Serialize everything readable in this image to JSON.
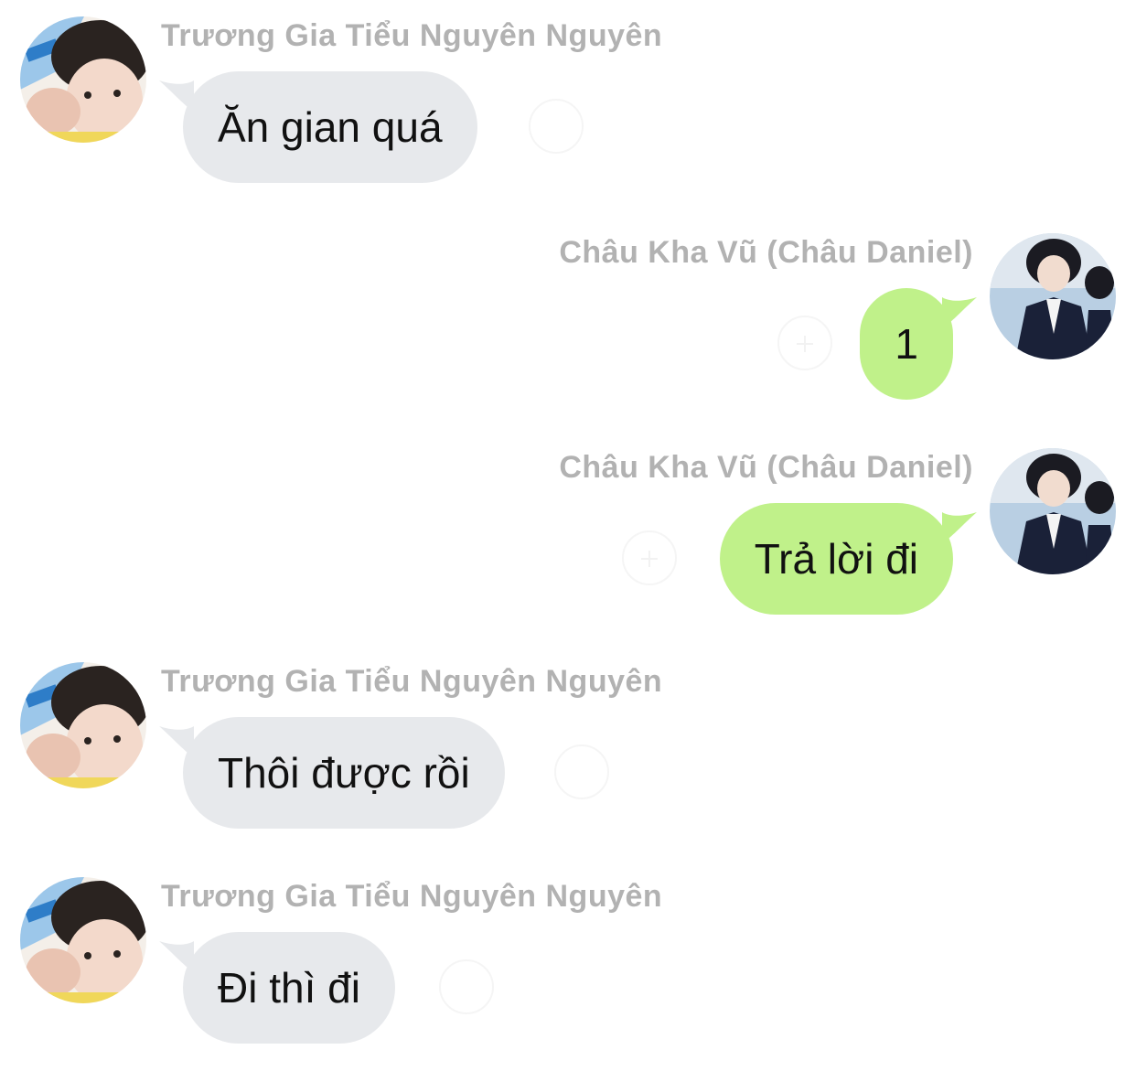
{
  "colors": {
    "incoming_bubble": "#e7e9ec",
    "outgoing_bubble": "#c0f18a",
    "sender_name": "#b2b2b2",
    "message_text": "#111111",
    "background": "#ffffff"
  },
  "messages": [
    {
      "side": "left",
      "sender": "Trương Gia Tiểu Nguyên Nguyên",
      "text": "Ăn gian quá",
      "avatar_icon": "user-avatar-icon",
      "reaction_icon": "add-reaction-icon"
    },
    {
      "side": "right",
      "sender": "Châu Kha Vũ (Châu Daniel)",
      "text": "1",
      "avatar_icon": "user-avatar-icon",
      "reaction_icon": "add-reaction-icon"
    },
    {
      "side": "right",
      "sender": "Châu Kha Vũ (Châu Daniel)",
      "text": "Trả lời đi",
      "avatar_icon": "user-avatar-icon",
      "reaction_icon": "add-reaction-icon"
    },
    {
      "side": "left",
      "sender": "Trương Gia Tiểu Nguyên Nguyên",
      "text": "Thôi được rồi",
      "avatar_icon": "user-avatar-icon",
      "reaction_icon": "add-reaction-icon"
    },
    {
      "side": "left",
      "sender": "Trương Gia Tiểu Nguyên Nguyên",
      "text": "Đi thì đi",
      "avatar_icon": "user-avatar-icon",
      "reaction_icon": "add-reaction-icon"
    }
  ]
}
